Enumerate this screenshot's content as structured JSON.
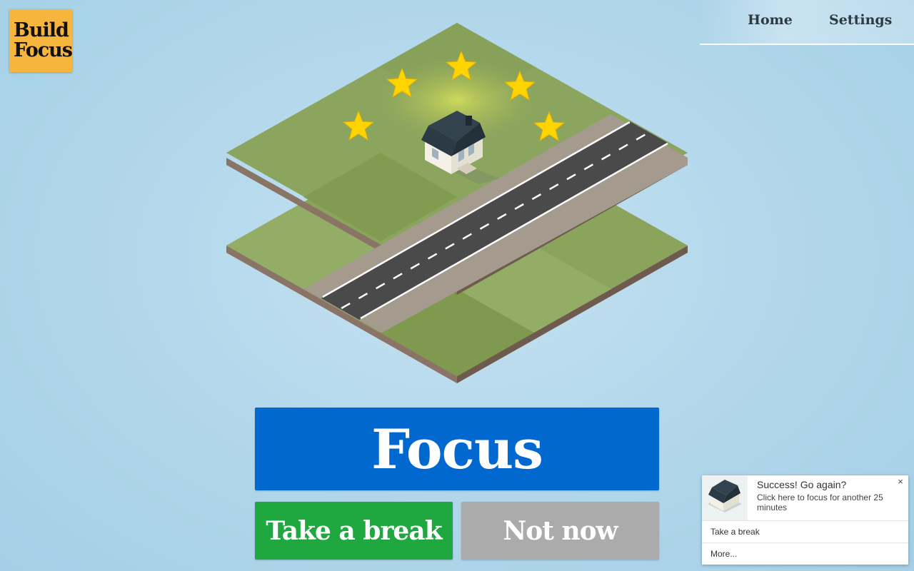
{
  "logo": {
    "line1": "Build",
    "line2": "Focus"
  },
  "nav": {
    "home": "Home",
    "settings": "Settings"
  },
  "buttons": {
    "focus": "Focus",
    "take_break": "Take a break",
    "not_now": "Not now"
  },
  "notification": {
    "title": "Success! Go again?",
    "body": "Click here to focus for another 25 minutes",
    "close": "×",
    "action_1": "Take a break",
    "action_2": "More..."
  },
  "scene": {
    "stars_count": 5
  },
  "colors": {
    "focus": "#0068cf",
    "break": "#1fa83f",
    "not_now": "#ababab",
    "logo": "#f6b53c"
  }
}
